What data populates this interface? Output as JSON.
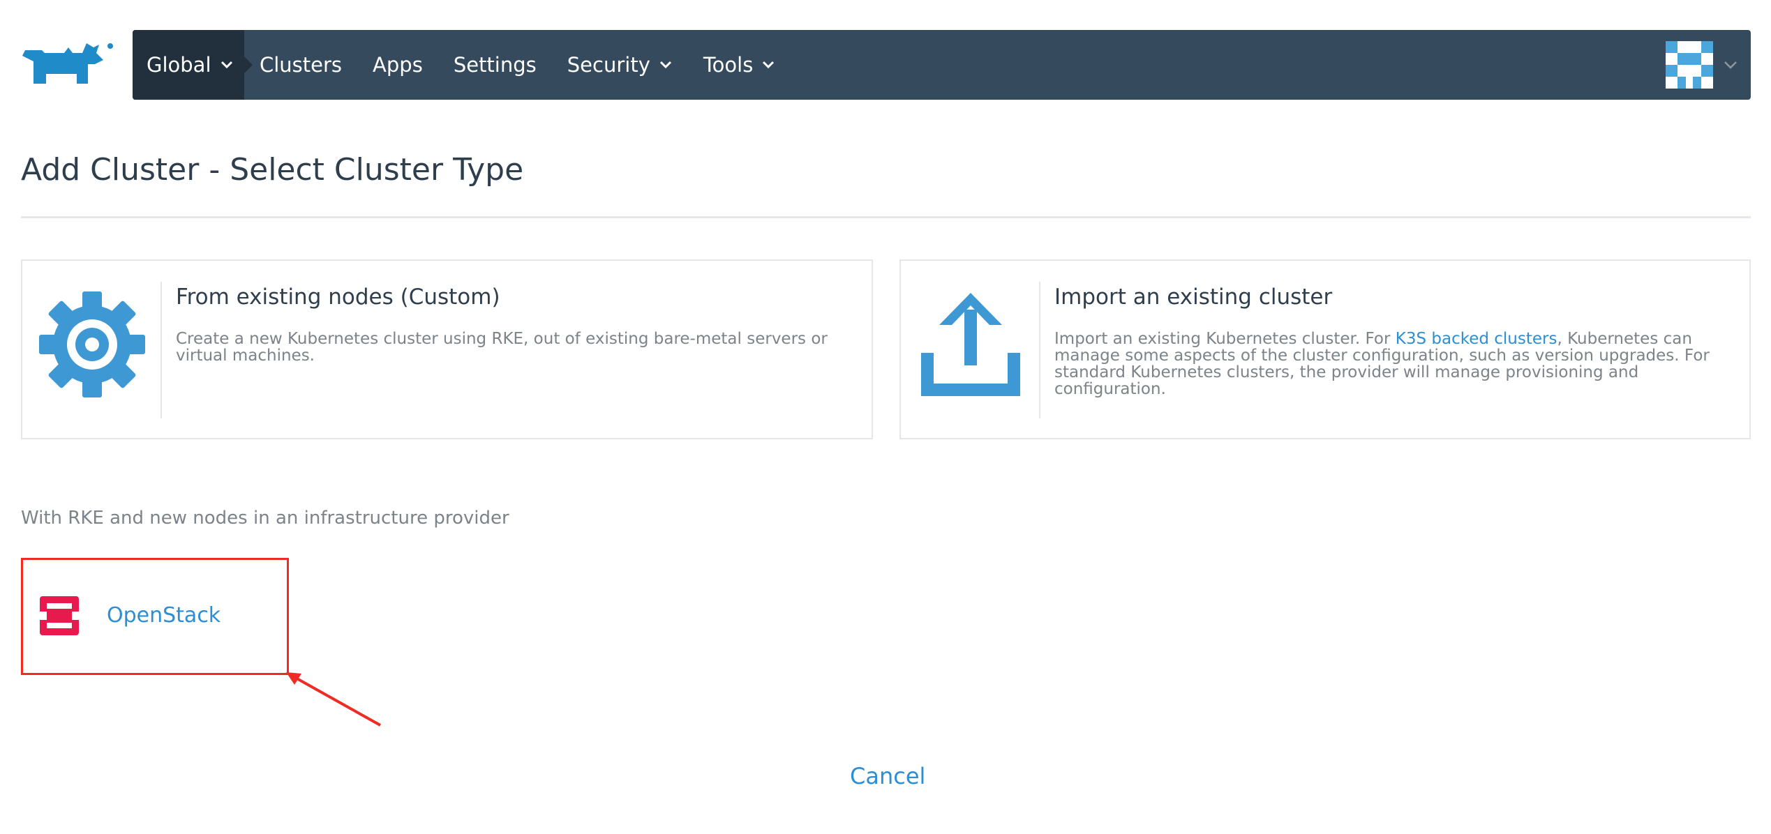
{
  "nav": {
    "global": "Global",
    "clusters": "Clusters",
    "apps": "Apps",
    "settings": "Settings",
    "security": "Security",
    "tools": "Tools"
  },
  "page": {
    "title": "Add Cluster - Select Cluster Type"
  },
  "cards": {
    "custom": {
      "title": "From existing nodes (Custom)",
      "description": "Create a new Kubernetes cluster using RKE, out of existing bare-metal servers or virtual machines.",
      "icon": "gear-icon"
    },
    "import": {
      "title": "Import an existing cluster",
      "description_before": "Import an existing Kubernetes cluster. For ",
      "link": "K3S backed clusters",
      "description_after": ", Kubernetes can manage some aspects of the cluster configuration, such as version upgrades. For standard Kubernetes clusters, the provider will manage provisioning and configuration.",
      "icon": "upload-icon"
    }
  },
  "providers": {
    "section_label": "With RKE and new nodes in an infrastructure provider",
    "items": [
      {
        "label": "OpenStack",
        "icon": "openstack-icon"
      }
    ]
  },
  "footer": {
    "cancel": "Cancel"
  },
  "colors": {
    "navbar": "#364a5e",
    "nav_active": "#222f3c",
    "accent": "#2c8fd4",
    "icon_blue": "#3d98d3",
    "highlight_red": "#ef2b24",
    "openstack_red": "#e8194c"
  }
}
